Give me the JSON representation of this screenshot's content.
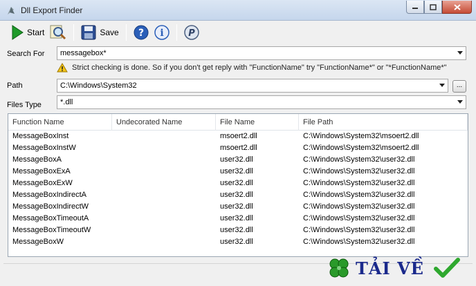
{
  "window": {
    "title": "Dll Export Finder"
  },
  "toolbar": {
    "start_label": "Start",
    "save_label": "Save"
  },
  "form": {
    "search_label": "Search For",
    "search_value": "messagebox*",
    "warning": "Strict checking is done. So if you don't get reply with \"FunctionName\" try \"FunctionName*\" or \"*FunctionName*\"",
    "path_label": "Path",
    "path_value": "C:\\Windows\\System32",
    "browse_label": "...",
    "filetype_label": "Files Type",
    "filetype_value": "*.dll"
  },
  "table": {
    "columns": [
      "Function Name",
      "Undecorated Name",
      "File Name",
      "File Path"
    ],
    "rows": [
      [
        "MessageBoxInst",
        "",
        "msoert2.dll",
        "C:\\Windows\\System32\\msoert2.dll"
      ],
      [
        "MessageBoxInstW",
        "",
        "msoert2.dll",
        "C:\\Windows\\System32\\msoert2.dll"
      ],
      [
        "MessageBoxA",
        "",
        "user32.dll",
        "C:\\Windows\\System32\\user32.dll"
      ],
      [
        "MessageBoxExA",
        "",
        "user32.dll",
        "C:\\Windows\\System32\\user32.dll"
      ],
      [
        "MessageBoxExW",
        "",
        "user32.dll",
        "C:\\Windows\\System32\\user32.dll"
      ],
      [
        "MessageBoxIndirectA",
        "",
        "user32.dll",
        "C:\\Windows\\System32\\user32.dll"
      ],
      [
        "MessageBoxIndirectW",
        "",
        "user32.dll",
        "C:\\Windows\\System32\\user32.dll"
      ],
      [
        "MessageBoxTimeoutA",
        "",
        "user32.dll",
        "C:\\Windows\\System32\\user32.dll"
      ],
      [
        "MessageBoxTimeoutW",
        "",
        "user32.dll",
        "C:\\Windows\\System32\\user32.dll"
      ],
      [
        "MessageBoxW",
        "",
        "user32.dll",
        "C:\\Windows\\System32\\user32.dll"
      ]
    ]
  },
  "watermark": {
    "text": "TẢI VỀ"
  },
  "icons": {
    "start": "play-icon",
    "search": "magnifier-icon",
    "save": "floppy-icon",
    "help": "help-icon",
    "info": "info-icon",
    "about": "p-circle-icon"
  },
  "colors": {
    "accent": "#1b2a8c",
    "start_green": "#1f9a2a",
    "help_blue": "#2b5fb8"
  }
}
